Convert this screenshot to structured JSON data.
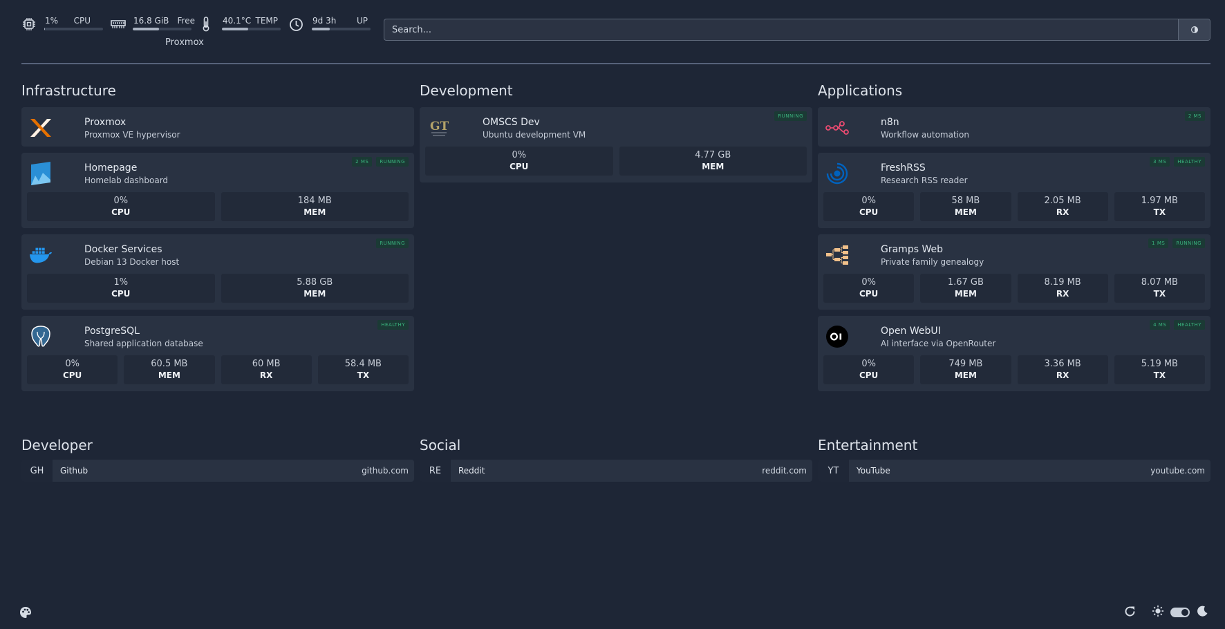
{
  "widgets": {
    "cpu": {
      "value": "1%",
      "label": "CPU",
      "level": 0.01
    },
    "memory": {
      "value": "16.8 GiB",
      "label": "Free",
      "level": 0.45,
      "sub": "Proxmox"
    },
    "temp": {
      "value": "40.1°C",
      "label": "TEMP",
      "level": 0.45
    },
    "uptime": {
      "value": "9d 3h",
      "label": "UP",
      "level": 0.3
    }
  },
  "search": {
    "placeholder": "Search..."
  },
  "groups": {
    "infrastructure": {
      "title": "Infrastructure",
      "services": [
        {
          "name": "Proxmox",
          "desc": "Proxmox VE hypervisor"
        },
        {
          "name": "Homepage",
          "desc": "Homelab dashboard",
          "badges": [
            "2 MS",
            "RUNNING"
          ],
          "stats": [
            {
              "v": "0%",
              "l": "CPU"
            },
            {
              "v": "184 MB",
              "l": "MEM"
            }
          ]
        },
        {
          "name": "Docker Services",
          "desc": "Debian 13 Docker host",
          "badges": [
            "RUNNING"
          ],
          "stats": [
            {
              "v": "1%",
              "l": "CPU"
            },
            {
              "v": "5.88 GB",
              "l": "MEM"
            }
          ]
        },
        {
          "name": "PostgreSQL",
          "desc": "Shared application database",
          "badges": [
            "HEALTHY"
          ],
          "stats": [
            {
              "v": "0%",
              "l": "CPU"
            },
            {
              "v": "60.5 MB",
              "l": "MEM"
            },
            {
              "v": "60 MB",
              "l": "RX"
            },
            {
              "v": "58.4 MB",
              "l": "TX"
            }
          ]
        }
      ]
    },
    "development": {
      "title": "Development",
      "services": [
        {
          "name": "OMSCS Dev",
          "desc": "Ubuntu development VM",
          "badges": [
            "RUNNING"
          ],
          "stats": [
            {
              "v": "0%",
              "l": "CPU"
            },
            {
              "v": "4.77 GB",
              "l": "MEM"
            }
          ]
        }
      ]
    },
    "applications": {
      "title": "Applications",
      "services": [
        {
          "name": "n8n",
          "desc": "Workflow automation",
          "badges": [
            "2 MS"
          ]
        },
        {
          "name": "FreshRSS",
          "desc": "Research RSS reader",
          "badges": [
            "3 MS",
            "HEALTHY"
          ],
          "stats": [
            {
              "v": "0%",
              "l": "CPU"
            },
            {
              "v": "58 MB",
              "l": "MEM"
            },
            {
              "v": "2.05 MB",
              "l": "RX"
            },
            {
              "v": "1.97 MB",
              "l": "TX"
            }
          ]
        },
        {
          "name": "Gramps Web",
          "desc": "Private family genealogy",
          "badges": [
            "1 MS",
            "RUNNING"
          ],
          "stats": [
            {
              "v": "0%",
              "l": "CPU"
            },
            {
              "v": "1.67 GB",
              "l": "MEM"
            },
            {
              "v": "8.19 MB",
              "l": "RX"
            },
            {
              "v": "8.07 MB",
              "l": "TX"
            }
          ]
        },
        {
          "name": "Open WebUI",
          "desc": "AI interface via OpenRouter",
          "badges": [
            "4 MS",
            "HEALTHY"
          ],
          "stats": [
            {
              "v": "0%",
              "l": "CPU"
            },
            {
              "v": "749 MB",
              "l": "MEM"
            },
            {
              "v": "3.36 MB",
              "l": "RX"
            },
            {
              "v": "5.19 MB",
              "l": "TX"
            }
          ]
        }
      ]
    }
  },
  "bookmarks": {
    "developer": {
      "title": "Developer",
      "items": [
        {
          "abbr": "GH",
          "name": "Github",
          "host": "github.com"
        }
      ]
    },
    "social": {
      "title": "Social",
      "items": [
        {
          "abbr": "RE",
          "name": "Reddit",
          "host": "reddit.com"
        }
      ]
    },
    "entertainment": {
      "title": "Entertainment",
      "items": [
        {
          "abbr": "YT",
          "name": "YouTube",
          "host": "youtube.com"
        }
      ]
    }
  },
  "colors": {
    "background": "#1e2636",
    "card": "#293242",
    "badge_text": "#3ab27d",
    "proxmox_orange": "#e57000",
    "n8n_pink": "#ea4b71"
  },
  "icons": {
    "cpu": "cpu-icon",
    "memory": "memory-icon",
    "temp": "thermometer-icon",
    "uptime": "clock-icon",
    "search_button": "search-engine-icon",
    "palette": "palette-icon",
    "refresh": "refresh-icon",
    "light": "sun-icon",
    "dark": "moon-icon"
  }
}
